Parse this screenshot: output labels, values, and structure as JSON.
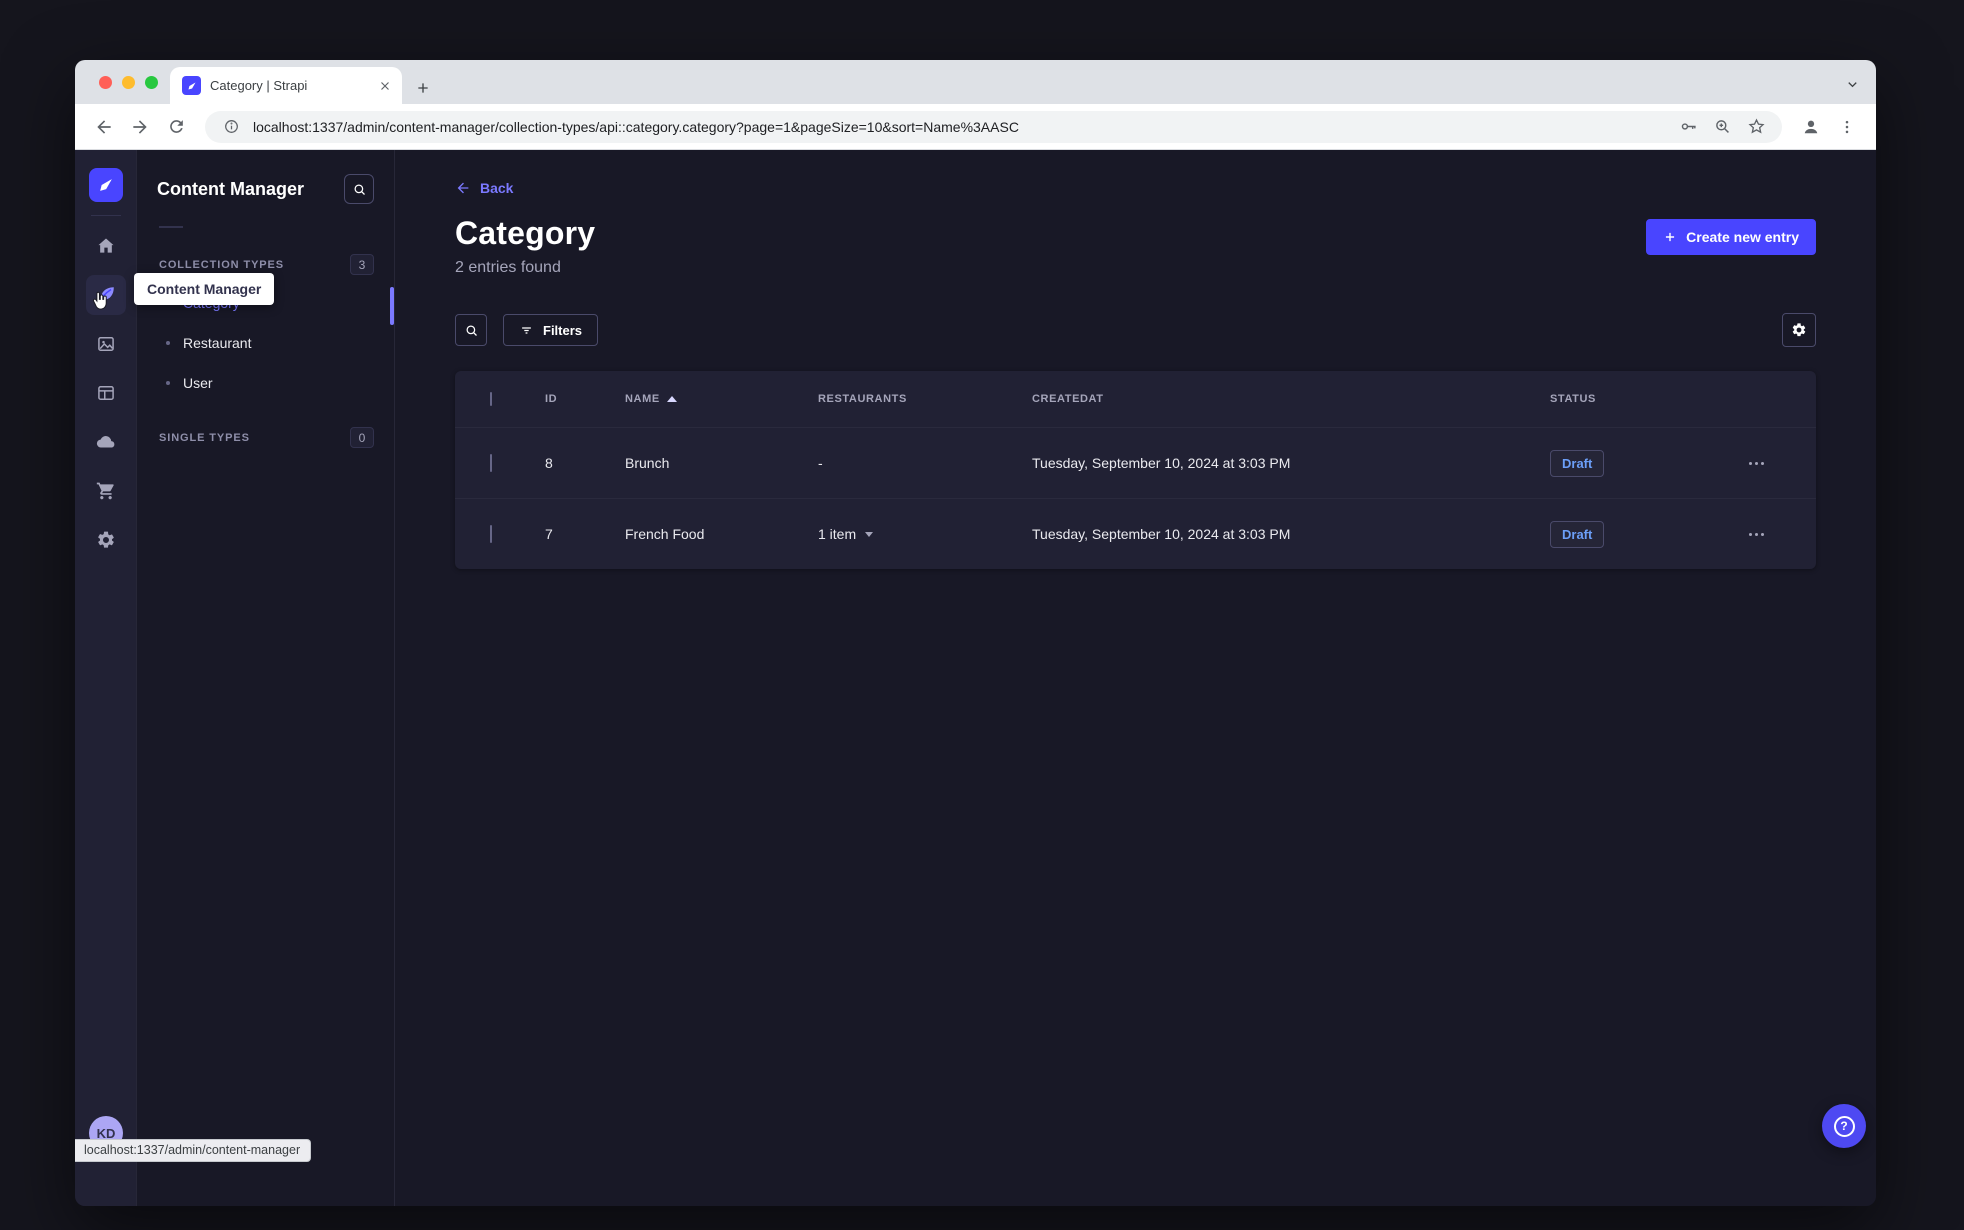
{
  "browser": {
    "tab": {
      "title": "Category | Strapi"
    },
    "url": "localhost:1337/admin/content-manager/collection-types/api::category.category?page=1&pageSize=10&sort=Name%3AASC",
    "status_bubble": "localhost:1337/admin/content-manager"
  },
  "nav": {
    "tooltip": "Content Manager",
    "avatar_initials": "KD",
    "icons": [
      "home-icon",
      "content-manager-icon",
      "media-library-icon",
      "content-type-builder-icon",
      "cloud-icon",
      "marketplace-icon",
      "settings-icon"
    ]
  },
  "subnav": {
    "title": "Content Manager",
    "sections": [
      {
        "label": "COLLECTION TYPES",
        "badge": "3",
        "items": [
          {
            "label": "Category",
            "active": true
          },
          {
            "label": "Restaurant",
            "active": false
          },
          {
            "label": "User",
            "active": false
          }
        ]
      },
      {
        "label": "SINGLE TYPES",
        "badge": "0",
        "items": []
      }
    ]
  },
  "main": {
    "back_label": "Back",
    "title": "Category",
    "subtitle": "2 entries found",
    "create_button": "Create new entry",
    "filters_button": "Filters",
    "table": {
      "columns": [
        "ID",
        "NAME",
        "RESTAURANTS",
        "CREATEDAT",
        "STATUS"
      ],
      "sort": {
        "column": "NAME",
        "direction": "ascending"
      },
      "rows": [
        {
          "id": "8",
          "name": "Brunch",
          "restaurants": "-",
          "createdAt": "Tuesday, September 10, 2024 at 3:03 PM",
          "status": "Draft"
        },
        {
          "id": "7",
          "name": "French Food",
          "restaurants": "1 item",
          "createdAt": "Tuesday, September 10, 2024 at 3:03 PM",
          "status": "Draft"
        }
      ]
    }
  },
  "colors": {
    "primary": "#4945ff",
    "primary_light": "#7b79ff",
    "draft_text": "#6c9ff8",
    "surface": "#212134",
    "background": "#181826"
  }
}
